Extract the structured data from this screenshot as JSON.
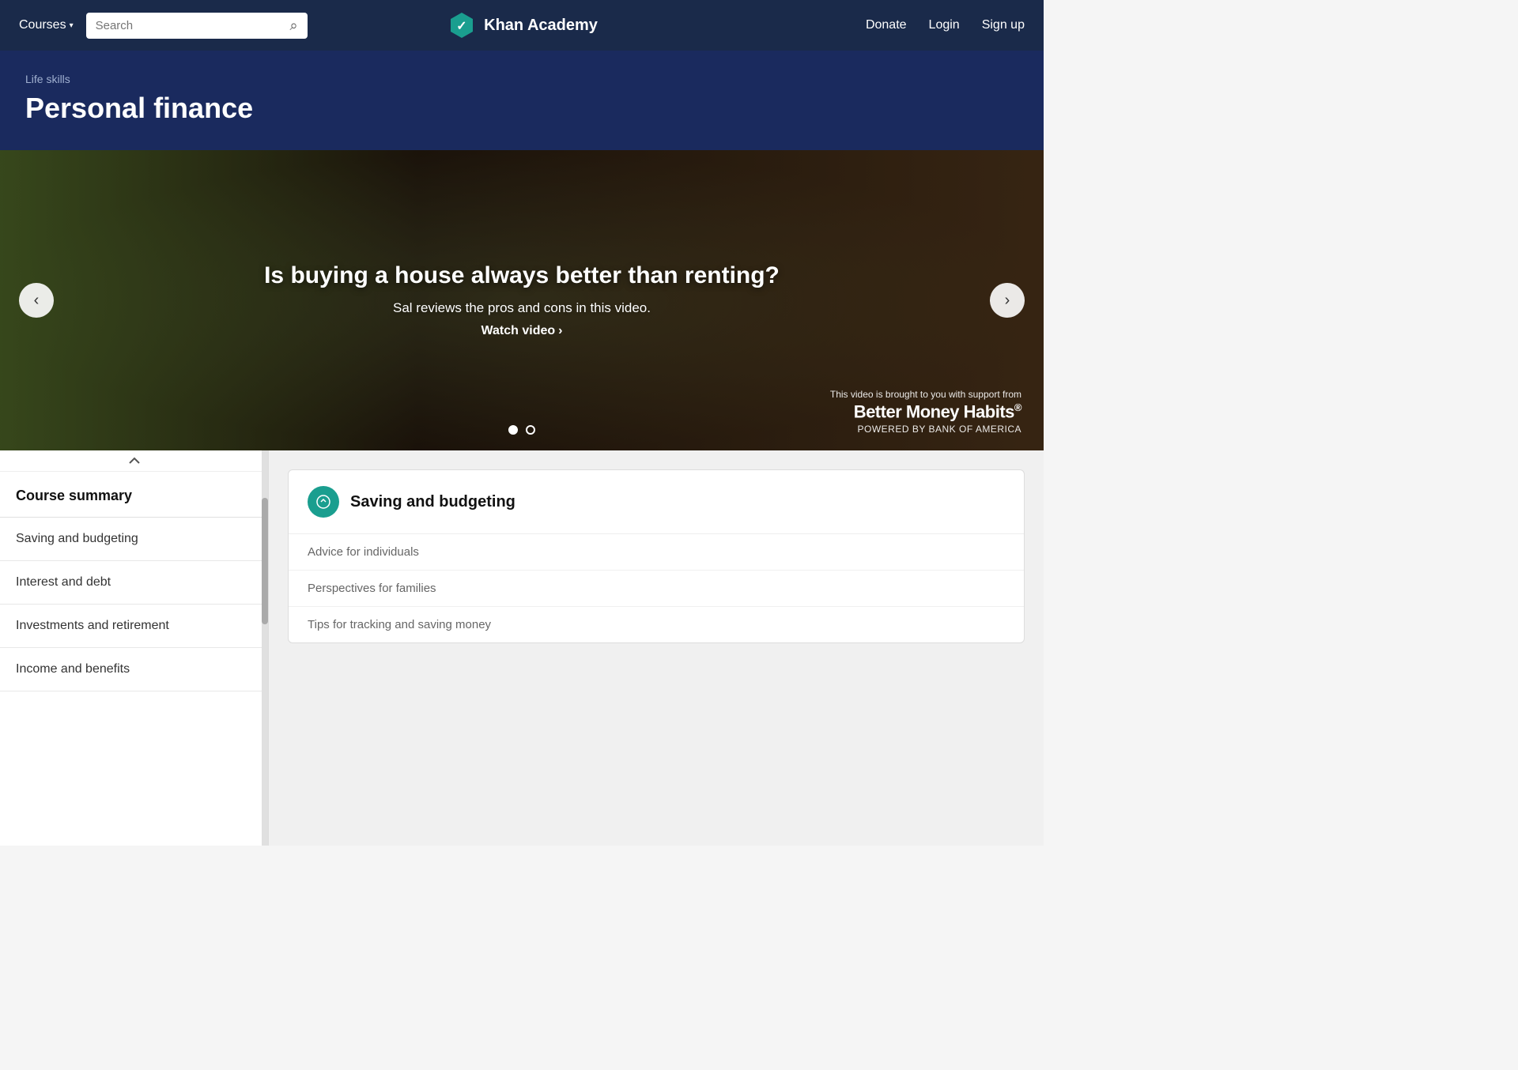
{
  "navbar": {
    "courses_label": "Courses",
    "search_placeholder": "Search",
    "logo_text": "Khan Academy",
    "donate_label": "Donate",
    "login_label": "Login",
    "signup_label": "Sign up"
  },
  "course_header": {
    "breadcrumb": "Life skills",
    "title": "Personal finance"
  },
  "carousel": {
    "heading": "Is buying a house always better than renting?",
    "subtext": "Sal reviews the pros and cons in this video.",
    "watch_label": "Watch video",
    "sponsor_intro": "This video is brought to you with support from",
    "sponsor_name": "Better Money Habits",
    "sponsor_reg": "®",
    "sponsor_powered": "Powered by BANK OF AMERICA"
  },
  "sidebar": {
    "title": "Course summary",
    "items": [
      {
        "label": "Saving and budgeting"
      },
      {
        "label": "Interest and debt"
      },
      {
        "label": "Investments and retirement"
      },
      {
        "label": "Income and benefits"
      }
    ]
  },
  "sections": [
    {
      "title": "Saving and budgeting",
      "links": [
        "Advice for individuals",
        "Perspectives for families",
        "Tips for tracking and saving money"
      ]
    }
  ]
}
